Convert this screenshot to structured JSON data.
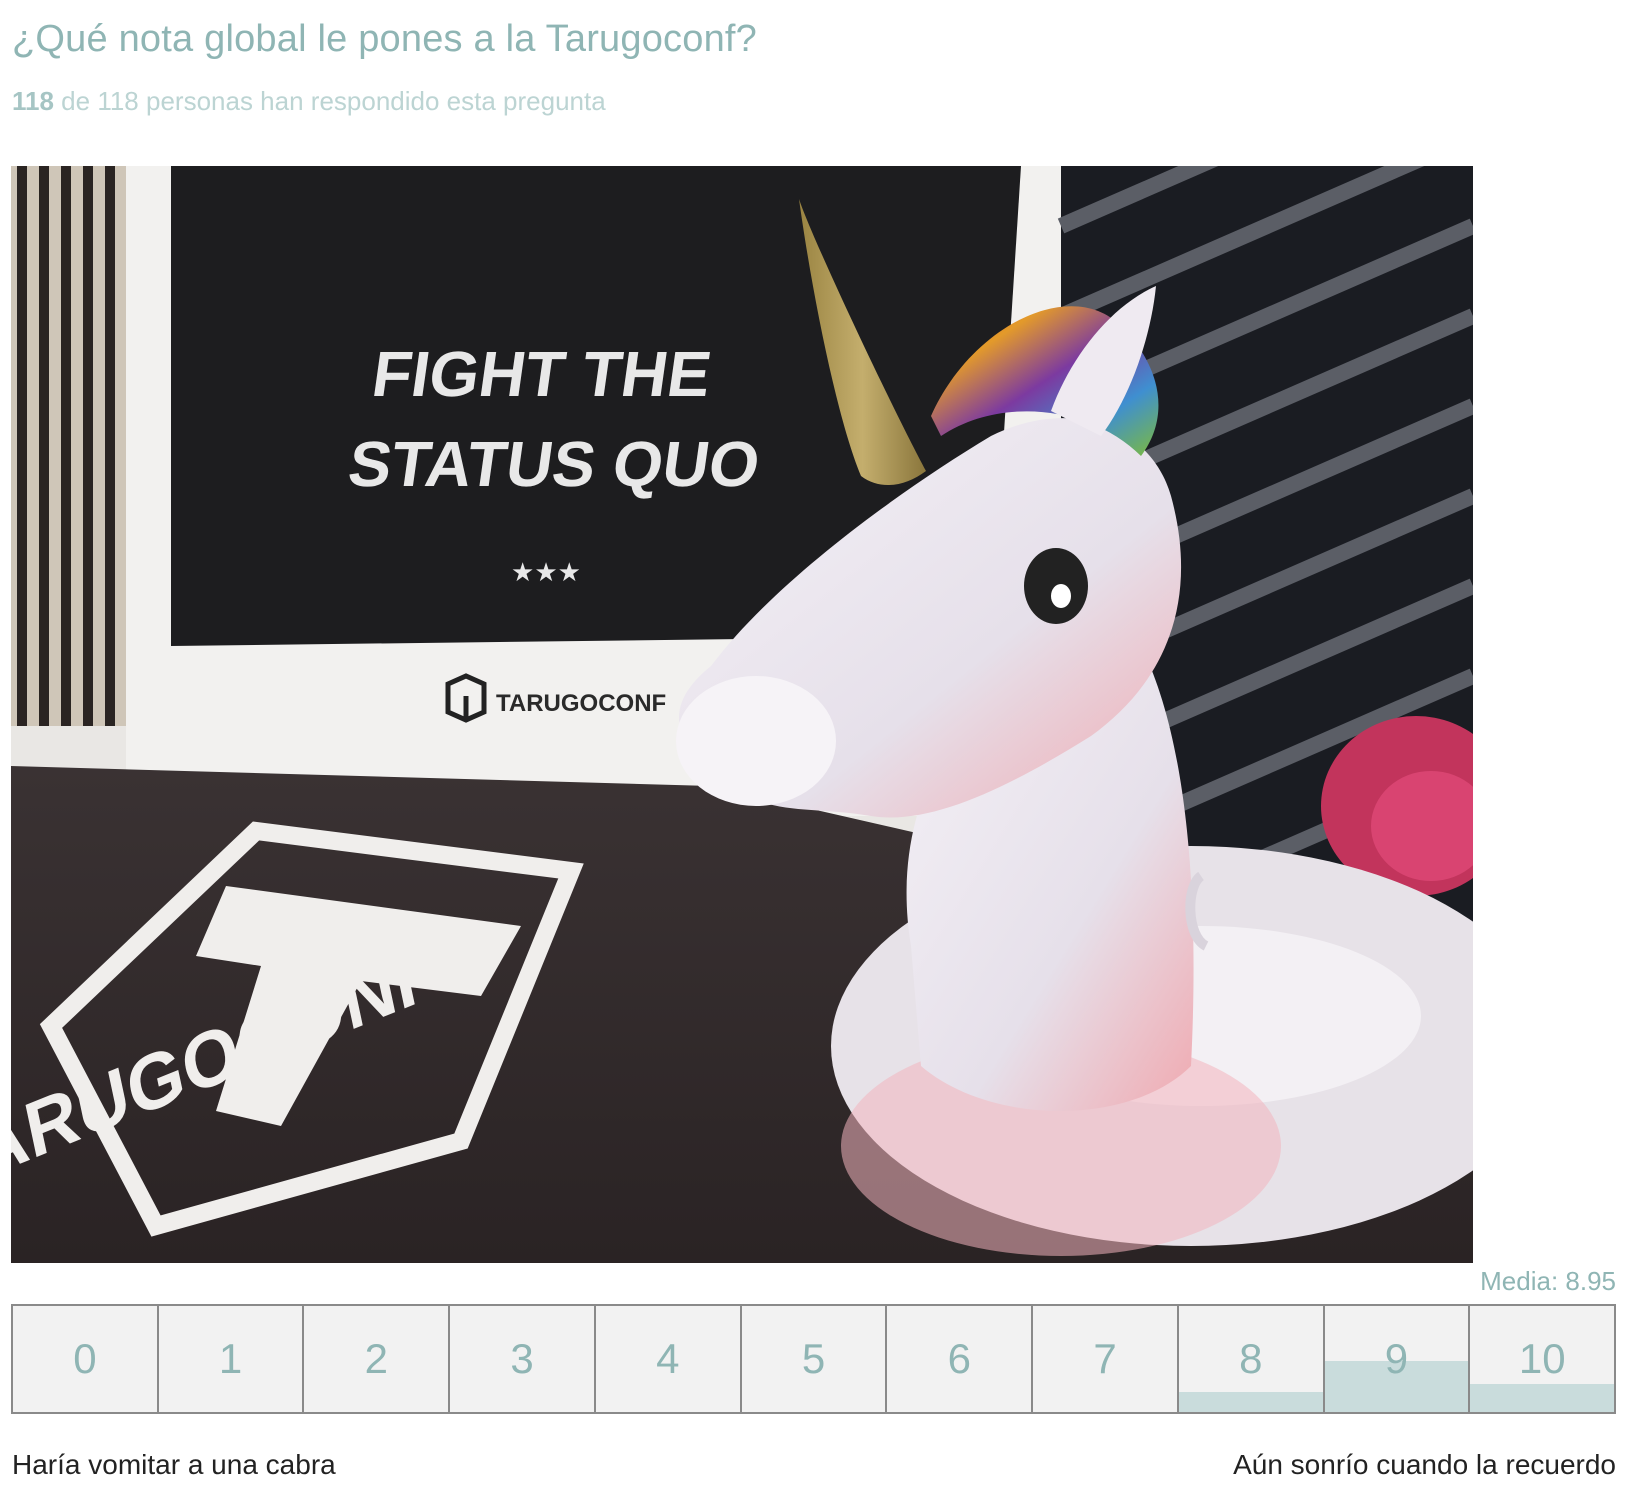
{
  "question": {
    "title": "¿Qué nota global le pones a la Tarugoconf?",
    "answered_count": "118",
    "answered_suffix": " de 118 personas han respondido esta pregunta"
  },
  "photo": {
    "board_line1": "FIGHT THE",
    "board_line2": "STATUS QUO",
    "board_stars": "★★★",
    "board_brand": "TARUGOCONF",
    "floor_brand": "TARUGOCONF"
  },
  "results": {
    "mean_label": "Media: 8.95",
    "scale": [
      {
        "label": "0",
        "share": 0
      },
      {
        "label": "1",
        "share": 0
      },
      {
        "label": "2",
        "share": 0
      },
      {
        "label": "3",
        "share": 0
      },
      {
        "label": "4",
        "share": 0
      },
      {
        "label": "5",
        "share": 0
      },
      {
        "label": "6",
        "share": 0
      },
      {
        "label": "7",
        "share": 0
      },
      {
        "label": "8",
        "share": 0.19
      },
      {
        "label": "9",
        "share": 0.48
      },
      {
        "label": "10",
        "share": 0.26
      }
    ],
    "min_label": "Haría vomitar a una cabra",
    "max_label": "Aún sonrío cuando la recuerdo"
  },
  "colors": {
    "accent": "#8fb5b4",
    "bar_fill": "#c9dcdc",
    "cell_bg": "#f2f2f2",
    "cell_border": "#8a8a8a"
  }
}
